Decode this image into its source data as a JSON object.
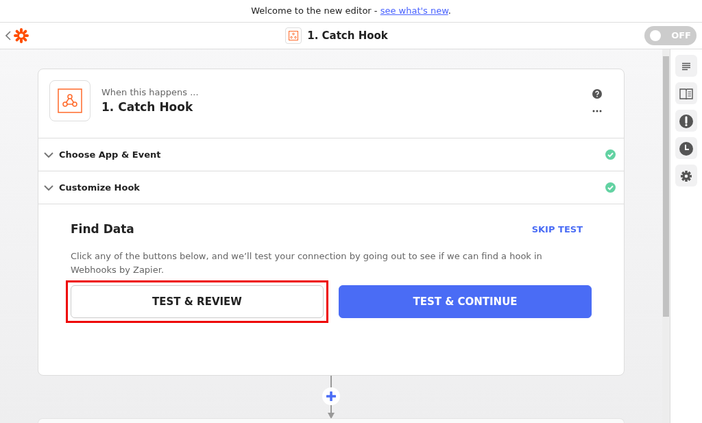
{
  "banner": {
    "text": "Welcome to the new editor - ",
    "link": "see what's new",
    "suffix": "."
  },
  "header": {
    "title": "1. Catch Hook",
    "toggle": {
      "label": "OFF",
      "on": false
    }
  },
  "step": {
    "subtitle": "When this happens ...",
    "title": "1. Catch Hook",
    "sections": [
      {
        "label": "Choose App & Event",
        "completed": true
      },
      {
        "label": "Customize Hook",
        "completed": true
      }
    ],
    "find_data": {
      "title": "Find Data",
      "skip": "SKIP TEST",
      "description": "Click any of the buttons below, and we’ll test your connection by going out to see if we can find a hook in Webhooks by Zapier.",
      "buttons": [
        {
          "label": "TEST & REVIEW",
          "kind": "outline",
          "highlighted": true
        },
        {
          "label": "TEST & CONTINUE",
          "kind": "primary",
          "highlighted": false
        }
      ]
    }
  }
}
